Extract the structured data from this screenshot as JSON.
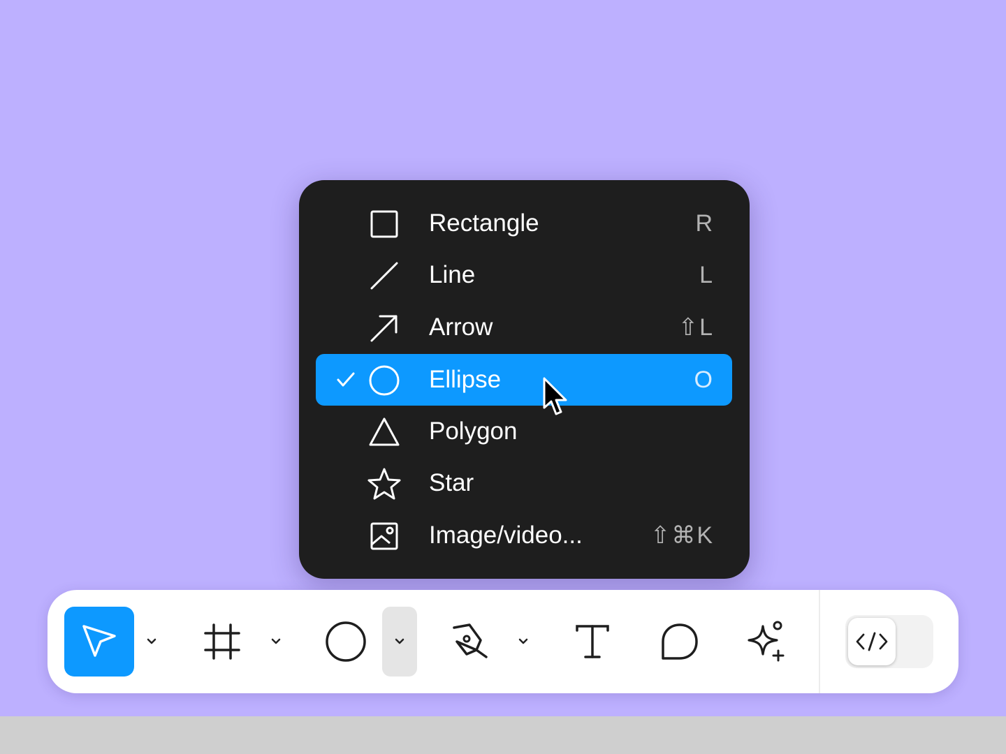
{
  "canvas": {
    "background": "#bdb0ff"
  },
  "menu": {
    "items": [
      {
        "label": "Rectangle",
        "shortcut": "R",
        "icon": "rectangle-icon",
        "selected": false
      },
      {
        "label": "Line",
        "shortcut": "L",
        "icon": "line-icon",
        "selected": false
      },
      {
        "label": "Arrow",
        "shortcut": "⇧L",
        "icon": "arrow-icon",
        "selected": false
      },
      {
        "label": "Ellipse",
        "shortcut": "O",
        "icon": "ellipse-icon",
        "selected": true
      },
      {
        "label": "Polygon",
        "shortcut": "",
        "icon": "polygon-icon",
        "selected": false
      },
      {
        "label": "Star",
        "shortcut": "",
        "icon": "star-icon",
        "selected": false
      },
      {
        "label": "Image/video...",
        "shortcut": "⇧⌘K",
        "icon": "image-icon",
        "selected": false
      }
    ],
    "selected_color": "#0d99ff"
  },
  "toolbar": {
    "tools": [
      {
        "name": "move-tool",
        "icon": "move-cursor-icon",
        "active": true
      },
      {
        "name": "frame-tool",
        "icon": "frame-icon",
        "active": false
      },
      {
        "name": "shape-tool",
        "icon": "ellipse-icon",
        "active": false
      },
      {
        "name": "pen-tool",
        "icon": "pen-icon",
        "active": false
      },
      {
        "name": "text-tool",
        "icon": "text-icon",
        "active": false
      },
      {
        "name": "comment-tool",
        "icon": "comment-icon",
        "active": false
      },
      {
        "name": "actions-tool",
        "icon": "sparkle-icon",
        "active": false
      }
    ],
    "dev_mode_toggle": {
      "icon": "code-icon",
      "on": false
    }
  }
}
